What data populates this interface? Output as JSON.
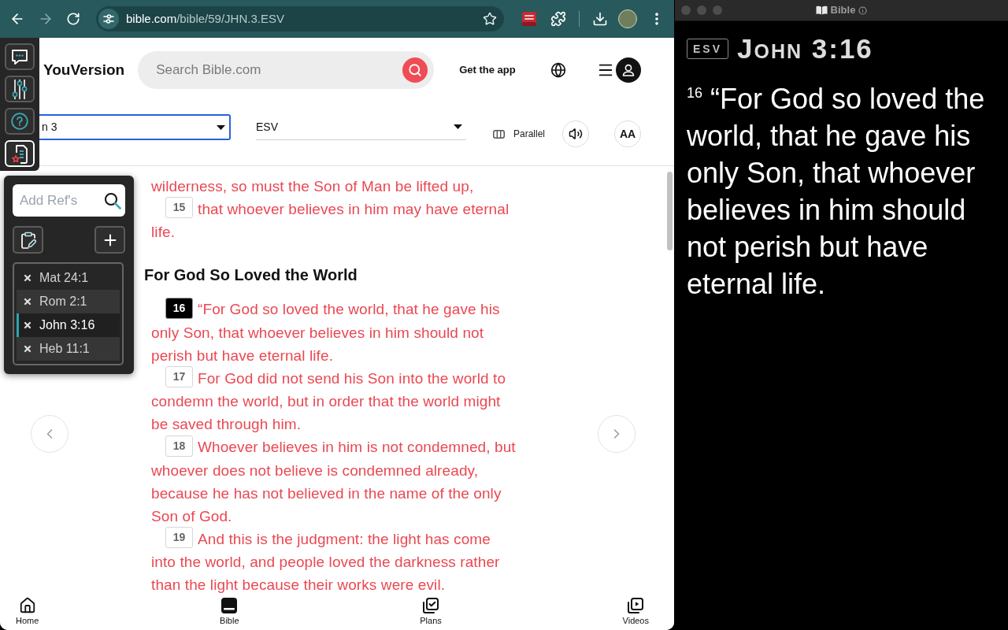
{
  "browser": {
    "url": {
      "domain": "bible.com",
      "path": "/bible/59/JHN.3.ESV"
    }
  },
  "header": {
    "logo": "YouVersion",
    "search": {
      "placeholder": "Search Bible.com"
    },
    "get_app": "Get the app"
  },
  "reader_controls": {
    "book": {
      "value": "n 3"
    },
    "version": {
      "value": "ESV"
    },
    "parallel": "Parallel",
    "text_size": "AA"
  },
  "passage": [
    {
      "kind": "text",
      "text": "wilderness, so must the Son of Man be lifted up,"
    },
    {
      "kind": "verse",
      "number": "15",
      "selected": false,
      "text": "that whoever believes in him may have eternal life."
    },
    {
      "kind": "heading",
      "text": "For God So Loved the World"
    },
    {
      "kind": "verse",
      "number": "16",
      "selected": true,
      "text": "“For God so loved the world, that he gave his only Son, that whoever believes in him should not perish but have eternal life."
    },
    {
      "kind": "verse",
      "number": "17",
      "selected": false,
      "text": "For God did not send his Son into the world to condemn the world, but in order that the world might be saved through him."
    },
    {
      "kind": "verse",
      "number": "18",
      "selected": false,
      "text": "Whoever believes in him is not condemned, but whoever does not believe is condemned already, because he has not believed in the name of the only Son of God."
    },
    {
      "kind": "verse",
      "number": "19",
      "selected": false,
      "text": "And this is the judgment: the light has come into the world, and people loved the darkness rather than the light because their works were evil."
    }
  ],
  "tool_rail": [
    {
      "kind": "comments",
      "selected": false
    },
    {
      "kind": "settings",
      "selected": false
    },
    {
      "kind": "help",
      "selected": false
    },
    {
      "kind": "references",
      "selected": true
    }
  ],
  "reference_panel": {
    "search": {
      "placeholder": "Add Ref's"
    },
    "references": [
      {
        "label": "Mat 24:1",
        "selected": false
      },
      {
        "label": "Rom 2:1",
        "selected": false
      },
      {
        "label": "John 3:16",
        "selected": true
      },
      {
        "label": "Heb 11:1",
        "selected": false
      }
    ]
  },
  "bottom_nav": [
    {
      "label": "Home",
      "selected": false
    },
    {
      "label": "Bible",
      "selected": true
    },
    {
      "label": "Plans",
      "selected": false
    },
    {
      "label": "Videos",
      "selected": false
    }
  ],
  "presenter": {
    "title": "Bible",
    "version": "ESV",
    "reference": "John 3:16",
    "verse": "$^{16}$ “For God so loved the world, that he gave his only Son, that whoever believes in him should not perish but have eternal life."
  }
}
